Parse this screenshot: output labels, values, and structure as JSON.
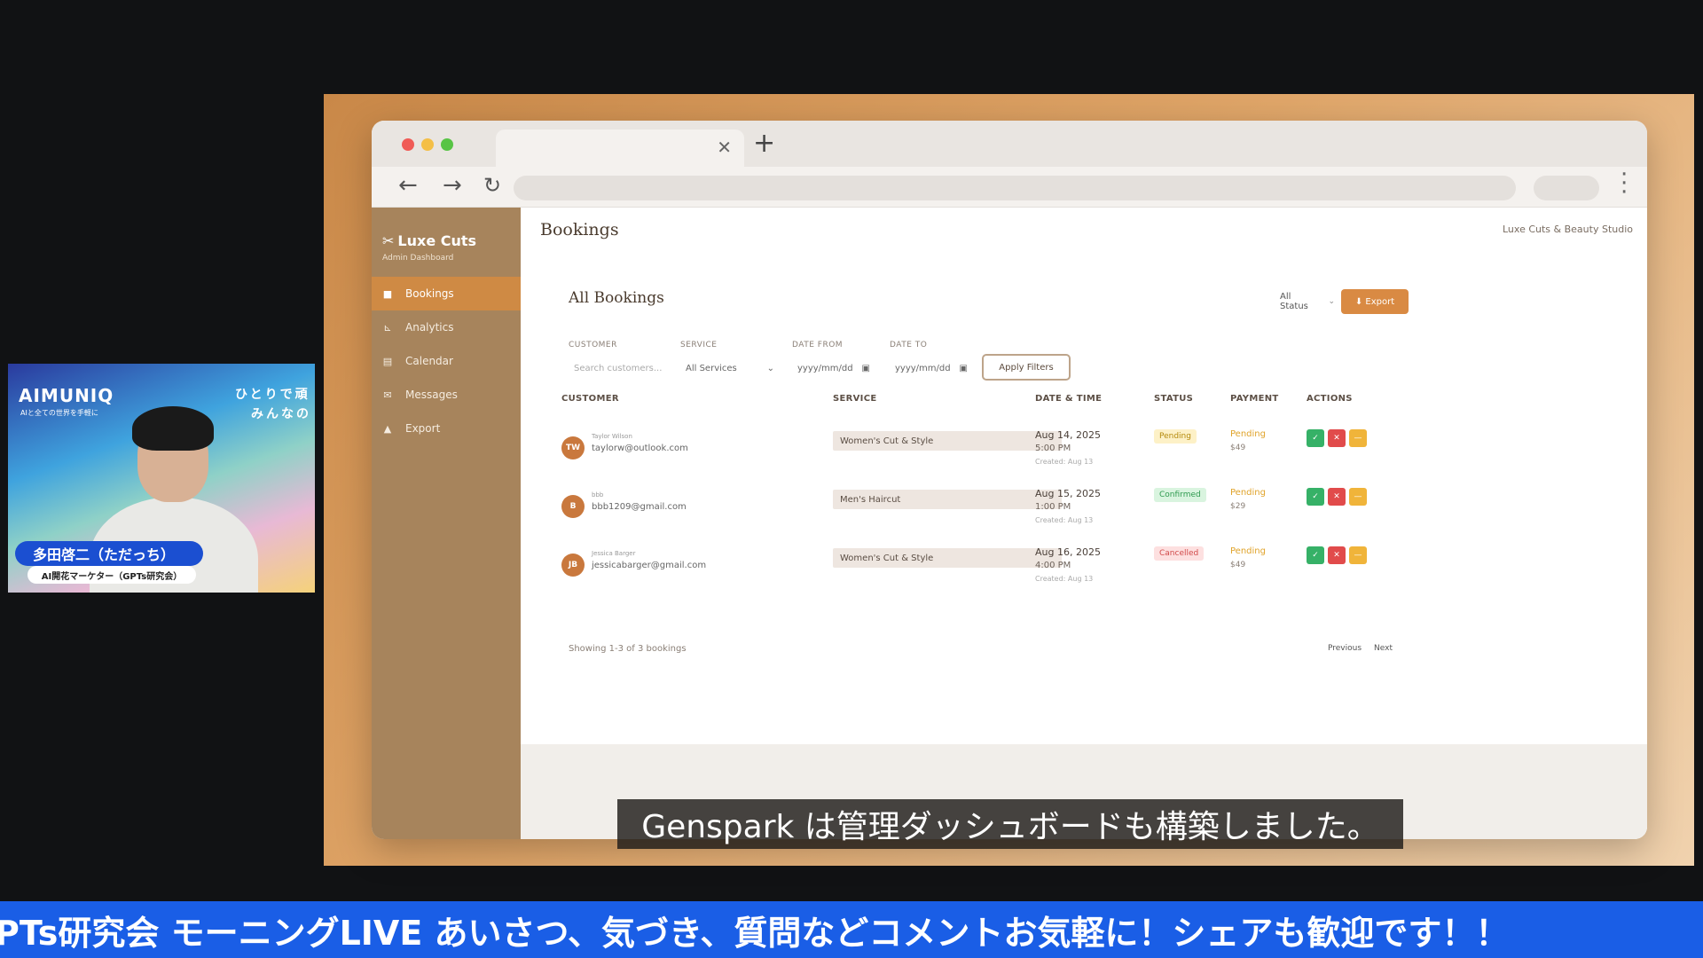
{
  "app": {
    "brand": "Luxe Cuts",
    "brand_sub": "Admin Dashboard",
    "page_title": "Bookings",
    "studio_name": "Luxe Cuts & Beauty Studio"
  },
  "sidebar": {
    "items": [
      {
        "label": "Bookings",
        "icon": "calendar-square-icon",
        "active": true
      },
      {
        "label": "Analytics",
        "icon": "chart-icon",
        "active": false
      },
      {
        "label": "Calendar",
        "icon": "calendar-icon",
        "active": false
      },
      {
        "label": "Messages",
        "icon": "envelope-icon",
        "active": false
      },
      {
        "label": "Export",
        "icon": "download-icon",
        "active": false
      }
    ]
  },
  "card": {
    "title": "All Bookings",
    "status_filter": "All Status",
    "export_label": "Export"
  },
  "filters": {
    "customer_label": "CUSTOMER",
    "customer_placeholder": "Search customers...",
    "service_label": "SERVICE",
    "service_value": "All Services",
    "date_from_label": "DATE FROM",
    "date_from_value": "yyyy/mm/dd",
    "date_to_label": "DATE TO",
    "date_to_value": "yyyy/mm/dd",
    "apply_label": "Apply Filters"
  },
  "table": {
    "headers": [
      "CUSTOMER",
      "SERVICE",
      "DATE & TIME",
      "STATUS",
      "PAYMENT",
      "ACTIONS"
    ],
    "rows": [
      {
        "initials": "TW",
        "name": "Taylor Wilson",
        "email": "taylorw@outlook.com",
        "service": "Women's Cut & Style",
        "date": "Aug 14, 2025",
        "time": "5:00 PM",
        "created": "Created: Aug 13",
        "status": "Pending",
        "payment_status": "Pending",
        "amount": "$49"
      },
      {
        "initials": "B",
        "name": "bbb",
        "email": "bbb1209@gmail.com",
        "service": "Men's Haircut",
        "date": "Aug 15, 2025",
        "time": "1:00 PM",
        "created": "Created: Aug 13",
        "status": "Confirmed",
        "payment_status": "Pending",
        "amount": "$29"
      },
      {
        "initials": "JB",
        "name": "Jessica Barger",
        "email": "jessicabarger@gmail.com",
        "service": "Women's Cut & Style",
        "date": "Aug 16, 2025",
        "time": "4:00 PM",
        "created": "Created: Aug 13",
        "status": "Cancelled",
        "payment_status": "Pending",
        "amount": "$49"
      }
    ],
    "showing": "Showing 1-3 of 3 bookings",
    "prev_label": "Previous",
    "next_label": "Next"
  },
  "overlay": {
    "subtitle": "Genspark は管理ダッシュボードも構築しました。",
    "ticker": "PTs研究会 モーニングLIVE あいさつ、気づき、質問などコメントお気軽に！シェアも歓迎です！！"
  },
  "webcam": {
    "logo": "AIMUNIQ",
    "logo_sub": "AIと全ての世界を手軽に",
    "tagline_1": "ひとりで頑",
    "tagline_2": "みんなの",
    "name": "多田啓二（ただっち）",
    "role": "AI開花マーケター（GPTs研究会）"
  },
  "colors": {
    "sidebar": "#a7845c",
    "accent": "#d98a43",
    "ticker": "#1a5ee6"
  }
}
